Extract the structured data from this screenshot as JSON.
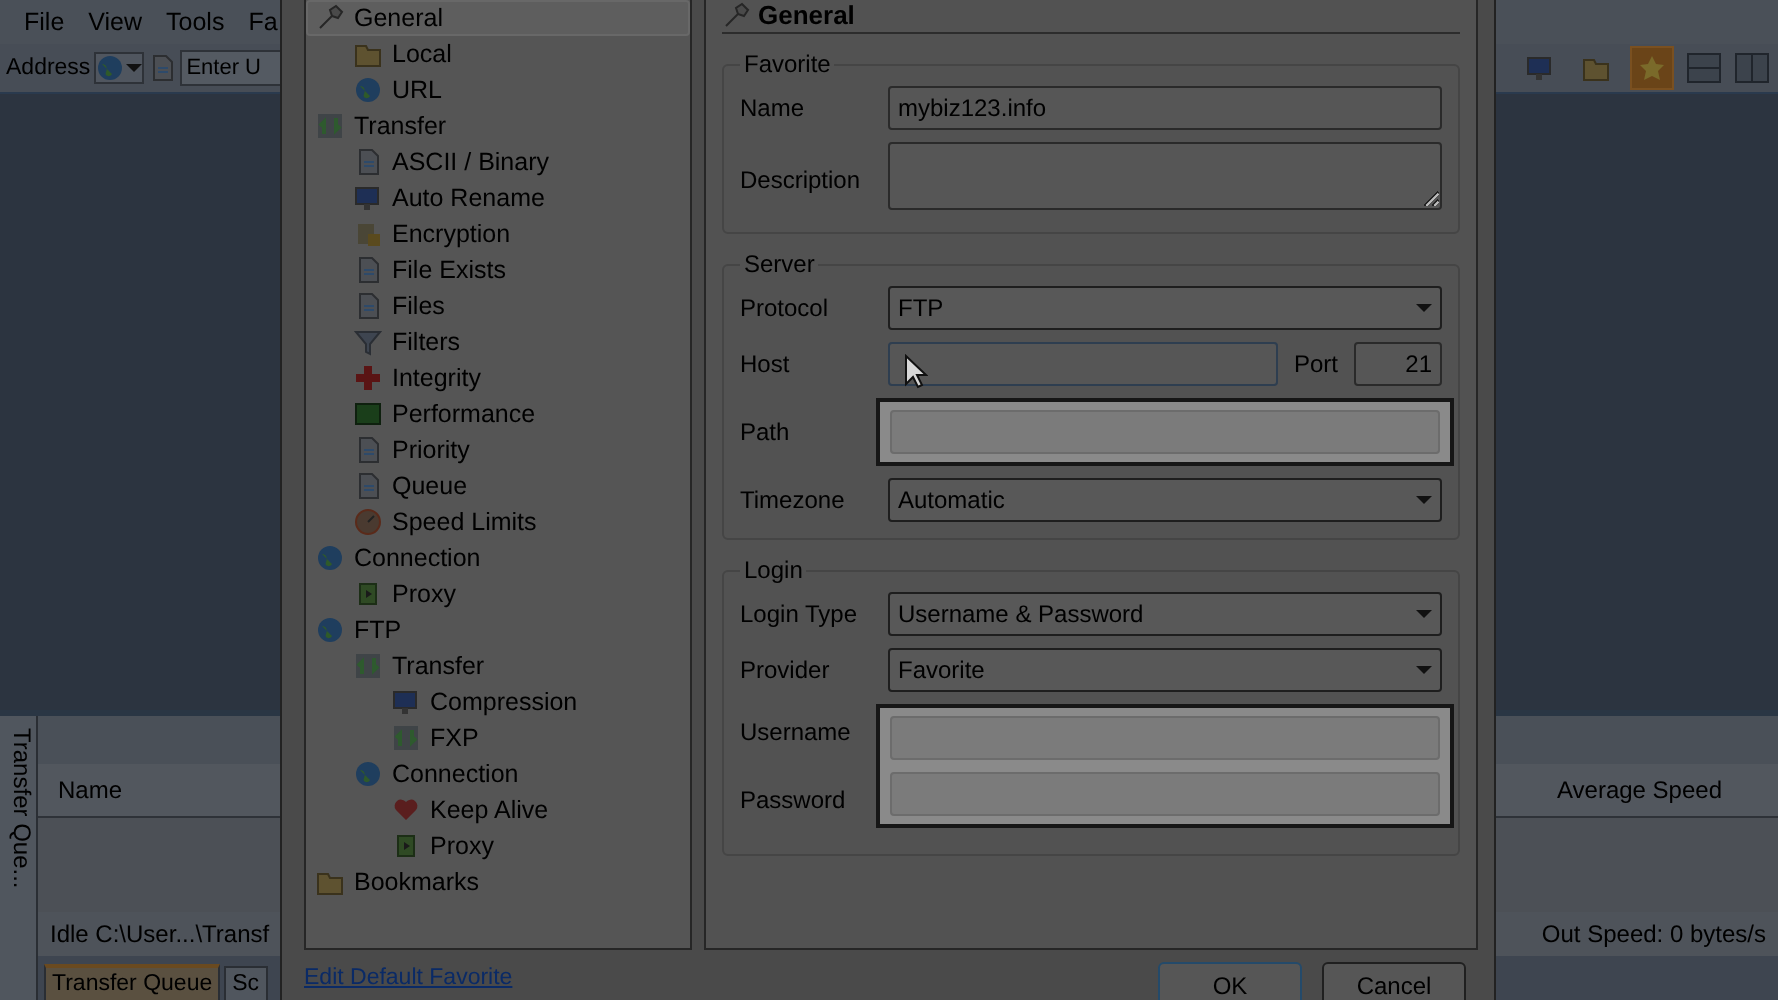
{
  "app": {
    "menu": [
      "File",
      "View",
      "Tools",
      "Fa"
    ],
    "address": {
      "label": "Address",
      "placeholder": "Enter U"
    },
    "toolbar": {
      "favorites_pressed": true
    },
    "queue_panel": {
      "side_tab": "Transfer Que...",
      "columns": [
        "Name",
        "Average Speed"
      ],
      "status": "Idle  C:\\User...\\Transf",
      "out_speed": "Out Speed: 0 bytes/s",
      "tabs": [
        {
          "label": "Transfer Queue",
          "selected": true
        },
        {
          "label": "Sc",
          "selected": false
        }
      ]
    }
  },
  "dialog": {
    "tree": [
      {
        "label": "General",
        "selected": true,
        "children": [
          {
            "label": "Local",
            "selected": false
          },
          {
            "label": "URL",
            "selected": false
          }
        ]
      },
      {
        "label": "Transfer",
        "selected": false,
        "children": [
          {
            "label": "ASCII / Binary",
            "selected": false
          },
          {
            "label": "Auto Rename",
            "selected": false
          },
          {
            "label": "Encryption",
            "selected": false
          },
          {
            "label": "File Exists",
            "selected": false
          },
          {
            "label": "Files",
            "selected": false
          },
          {
            "label": "Filters",
            "selected": false
          },
          {
            "label": "Integrity",
            "selected": false
          },
          {
            "label": "Performance",
            "selected": false
          },
          {
            "label": "Priority",
            "selected": false
          },
          {
            "label": "Queue",
            "selected": false
          },
          {
            "label": "Speed Limits",
            "selected": false
          }
        ]
      },
      {
        "label": "Connection",
        "selected": false,
        "children": [
          {
            "label": "Proxy",
            "selected": false
          }
        ]
      },
      {
        "label": "FTP",
        "selected": false,
        "children": [
          {
            "label": "Transfer",
            "selected": false,
            "children": [
              {
                "label": "Compression",
                "selected": false
              },
              {
                "label": "FXP",
                "selected": false
              }
            ]
          },
          {
            "label": "Connection",
            "selected": false,
            "children": [
              {
                "label": "Keep Alive",
                "selected": false
              },
              {
                "label": "Proxy",
                "selected": false
              }
            ]
          }
        ]
      },
      {
        "label": "Bookmarks",
        "selected": false
      }
    ],
    "page_title": "General",
    "groups": [
      {
        "title": "Favorite",
        "fields": [
          {
            "kind": "text",
            "label": "Name",
            "value": "mybiz123.info",
            "highlighted": false
          },
          {
            "kind": "textarea",
            "label": "Description",
            "highlighted": false
          }
        ]
      },
      {
        "title": "Server",
        "fields": [
          {
            "kind": "select",
            "label": "Protocol",
            "value": "FTP",
            "highlighted": false
          },
          {
            "kind": "text",
            "label": "Host",
            "focused": true,
            "highlighted": false,
            "port": {
              "label": "Port",
              "value": "21"
            }
          },
          {
            "kind": "text",
            "label": "Path",
            "highlighted": true
          },
          {
            "kind": "select",
            "label": "Timezone",
            "value": "Automatic",
            "highlighted": false
          }
        ]
      },
      {
        "title": "Login",
        "fields": [
          {
            "kind": "select",
            "label": "Login Type",
            "value": "Username & Password",
            "highlighted": false
          },
          {
            "kind": "select",
            "label": "Provider",
            "value": "Favorite",
            "highlighted": false
          },
          {
            "kind": "text",
            "label": "Username",
            "highlighted": true
          },
          {
            "kind": "text",
            "label": "Password",
            "highlighted": true
          }
        ]
      }
    ],
    "link": "Edit Default Favorite",
    "buttons": [
      {
        "label": "OK",
        "default": true
      },
      {
        "label": "Cancel",
        "default": false
      }
    ]
  }
}
